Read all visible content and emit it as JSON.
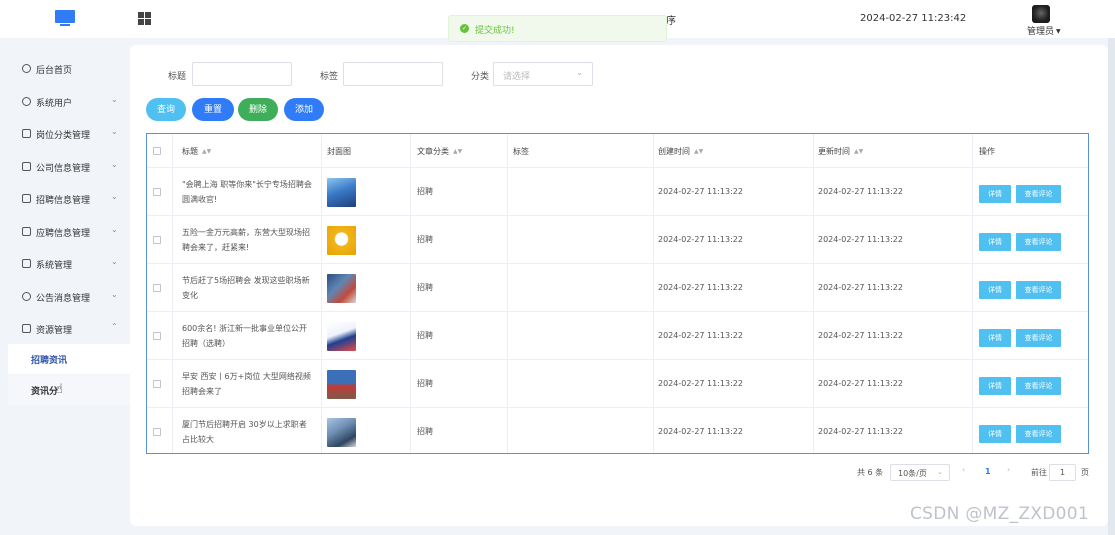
{
  "header": {
    "title_fragment": "序",
    "datetime": "2024-02-27 11:23:42",
    "user": "管理员"
  },
  "toast": {
    "message": "提交成功!"
  },
  "sidebar": {
    "items": [
      {
        "label": "后台首页"
      },
      {
        "label": "系统用户"
      },
      {
        "label": "岗位分类管理"
      },
      {
        "label": "公司信息管理"
      },
      {
        "label": "招聘信息管理"
      },
      {
        "label": "应聘信息管理"
      },
      {
        "label": "系统管理"
      },
      {
        "label": "公告消息管理"
      },
      {
        "label": "资源管理"
      }
    ],
    "subitems": [
      {
        "label": "招聘资讯"
      },
      {
        "label": "资讯分"
      }
    ]
  },
  "filters": {
    "title_label": "标题",
    "tag_label": "标签",
    "category_label": "分类",
    "category_placeholder": "请选择"
  },
  "buttons": {
    "query": "查询",
    "reset": "重置",
    "delete": "删除",
    "add": "添加"
  },
  "table": {
    "headers": {
      "title": "标题",
      "cover": "封面图",
      "category": "文章分类",
      "tags": "标签",
      "created": "创建时间",
      "updated": "更新时间",
      "actions": "操作"
    },
    "rows": [
      {
        "title": "\"会聘上海 职等你来\"长宁专场招聘会圆满收官!",
        "category": "招聘",
        "created": "2024-02-27 11:13:22",
        "updated": "2024-02-27 11:13:22"
      },
      {
        "title": "五险一金万元高薪，东营大型现场招聘会来了，赶紧来!",
        "category": "招聘",
        "created": "2024-02-27 11:13:22",
        "updated": "2024-02-27 11:13:22"
      },
      {
        "title": "节后赶了5场招聘会 发现这些职场新变化",
        "category": "招聘",
        "created": "2024-02-27 11:13:22",
        "updated": "2024-02-27 11:13:22"
      },
      {
        "title": "600余名! 浙江新一批事业单位公开招聘（选聘）",
        "category": "招聘",
        "created": "2024-02-27 11:13:22",
        "updated": "2024-02-27 11:13:22"
      },
      {
        "title": "早安 西安丨6万+岗位 大型网络视频招聘会来了",
        "category": "招聘",
        "created": "2024-02-27 11:13:22",
        "updated": "2024-02-27 11:13:22"
      },
      {
        "title": "厦门节后招聘开启 30岁以上求职者占比较大",
        "category": "招聘",
        "created": "2024-02-27 11:13:22",
        "updated": "2024-02-27 11:13:22"
      }
    ],
    "detail_label": "详情",
    "comments_label": "查看评论"
  },
  "pagination": {
    "total": "共 6 条",
    "page_size": "10条/页",
    "current_page": "1",
    "goto_label": "前往",
    "goto_value": "1",
    "page_suffix": "页"
  },
  "watermark": "CSDN @MZ_ZXD001",
  "colors": {
    "primary": "#2f7cf6",
    "query_btn": "#4fc0f0",
    "delete_btn": "#3fae5a",
    "success": "#67c23a"
  }
}
